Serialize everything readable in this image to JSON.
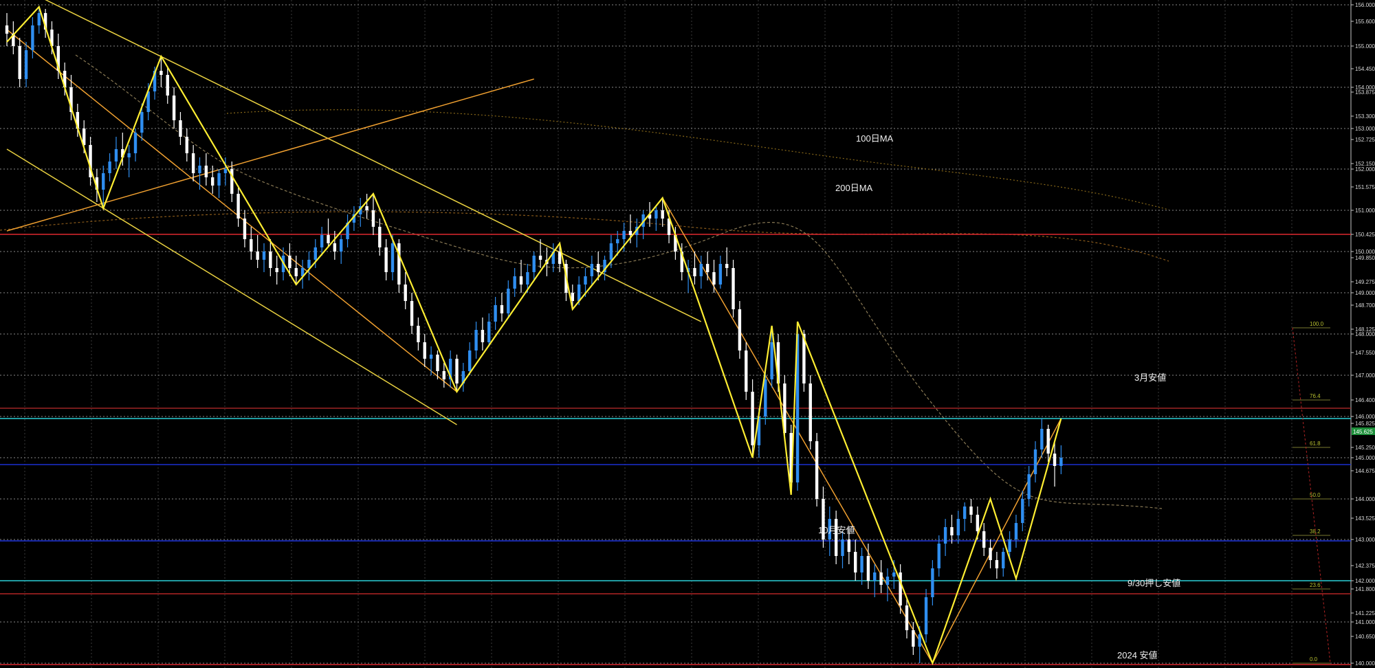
{
  "chart_data": {
    "type": "candlestick",
    "title": "",
    "xlabel": "",
    "ylabel": "",
    "ylim": [
      139.9,
      156.1
    ],
    "grid": true,
    "price_axis_labels": [
      "156.000",
      "155.600",
      "155.000",
      "154.450",
      "154.000",
      "153.875",
      "153.300",
      "153.000",
      "152.725",
      "152.150",
      "152.000",
      "151.575",
      "151.000",
      "150.425",
      "150.000",
      "149.850",
      "149.275",
      "149.000",
      "148.700",
      "148.125",
      "148.000",
      "147.550",
      "147.000",
      "146.400",
      "146.000",
      "145.825",
      "145.250",
      "145.000",
      "144.675",
      "144.000",
      "143.525",
      "143.000",
      "142.375",
      "142.000",
      "141.800",
      "141.225",
      "141.000",
      "140.650",
      "140.000"
    ],
    "price_marker": "145.625",
    "annotations": [
      {
        "text": "100日MA"
      },
      {
        "text": "200日MA"
      },
      {
        "text": "3月安値"
      },
      {
        "text": "10月安値"
      },
      {
        "text": "9/30押し安値"
      },
      {
        "text": "2024 安値"
      }
    ],
    "fib_labels": [
      "100.0",
      "76.4",
      "61.8",
      "50.0",
      "38.2",
      "23.6",
      "0.0"
    ],
    "horizontal_levels": [
      {
        "price": 150.425,
        "color": "#e0282f"
      },
      {
        "price": 146.2,
        "color": "#9e2626"
      },
      {
        "price": 145.95,
        "color": "#2ad0d8"
      },
      {
        "price": 144.82,
        "color": "#1a2fd0"
      },
      {
        "price": 142.98,
        "color": "#2036e0"
      },
      {
        "price": 142.0,
        "color": "#2ad0d8"
      },
      {
        "price": 141.68,
        "color": "#b32424"
      },
      {
        "price": 139.97,
        "color": "#e0282f"
      }
    ],
    "zigzag_pivots": [
      {
        "i": 0,
        "p": 155.1
      },
      {
        "i": 5,
        "p": 155.95
      },
      {
        "i": 15,
        "p": 151.05
      },
      {
        "i": 24,
        "p": 154.75
      },
      {
        "i": 45,
        "p": 149.2
      },
      {
        "i": 57,
        "p": 151.4
      },
      {
        "i": 70,
        "p": 146.6
      },
      {
        "i": 86,
        "p": 150.2
      },
      {
        "i": 88,
        "p": 148.6
      },
      {
        "i": 102,
        "p": 151.3
      },
      {
        "i": 116,
        "p": 145.0
      },
      {
        "i": 119,
        "p": 148.2
      },
      {
        "i": 122,
        "p": 144.1
      },
      {
        "i": 123,
        "p": 148.3
      },
      {
        "i": 144,
        "p": 140.0
      },
      {
        "i": 153,
        "p": 144.0
      },
      {
        "i": 157,
        "p": 142.05
      },
      {
        "i": 164,
        "p": 145.95
      }
    ],
    "candles_ohlc": [
      [
        155.5,
        155.8,
        155.0,
        155.3
      ],
      [
        155.3,
        155.6,
        154.8,
        155.0
      ],
      [
        155.0,
        155.2,
        154.0,
        154.2
      ],
      [
        154.2,
        155.1,
        154.0,
        154.9
      ],
      [
        154.9,
        155.7,
        154.7,
        155.5
      ],
      [
        155.5,
        155.95,
        155.3,
        155.8
      ],
      [
        155.8,
        155.9,
        155.2,
        155.4
      ],
      [
        155.4,
        155.6,
        154.8,
        155.0
      ],
      [
        155.0,
        155.3,
        154.2,
        154.4
      ],
      [
        154.4,
        154.6,
        153.8,
        154.0
      ],
      [
        154.0,
        154.3,
        153.2,
        153.4
      ],
      [
        153.4,
        153.6,
        152.8,
        153.0
      ],
      [
        153.0,
        153.2,
        152.4,
        152.6
      ],
      [
        152.6,
        152.8,
        151.6,
        151.8
      ],
      [
        151.8,
        152.0,
        151.2,
        151.5
      ],
      [
        151.5,
        152.1,
        151.05,
        151.9
      ],
      [
        151.9,
        152.4,
        151.7,
        152.2
      ],
      [
        152.2,
        152.8,
        152.0,
        152.5
      ],
      [
        152.5,
        152.9,
        152.1,
        152.3
      ],
      [
        152.3,
        152.6,
        151.8,
        152.4
      ],
      [
        152.4,
        153.0,
        152.2,
        152.9
      ],
      [
        152.9,
        153.6,
        152.7,
        153.4
      ],
      [
        153.4,
        154.1,
        153.2,
        153.9
      ],
      [
        153.9,
        154.5,
        153.7,
        154.4
      ],
      [
        154.4,
        154.75,
        154.0,
        154.3
      ],
      [
        154.3,
        154.5,
        153.6,
        153.8
      ],
      [
        153.8,
        154.0,
        153.0,
        153.2
      ],
      [
        153.2,
        153.4,
        152.6,
        152.8
      ],
      [
        152.8,
        153.0,
        152.2,
        152.4
      ],
      [
        152.4,
        152.6,
        151.7,
        151.9
      ],
      [
        151.9,
        152.3,
        151.5,
        152.1
      ],
      [
        152.1,
        152.4,
        151.6,
        151.8
      ],
      [
        151.8,
        152.1,
        151.4,
        151.6
      ],
      [
        151.6,
        152.0,
        151.3,
        151.9
      ],
      [
        151.9,
        152.3,
        151.6,
        152.0
      ],
      [
        152.0,
        152.2,
        151.2,
        151.4
      ],
      [
        151.4,
        151.6,
        150.6,
        150.8
      ],
      [
        150.8,
        151.0,
        150.1,
        150.3
      ],
      [
        150.3,
        150.6,
        149.8,
        150.0
      ],
      [
        150.0,
        150.4,
        149.6,
        149.8
      ],
      [
        149.8,
        150.2,
        149.5,
        150.0
      ],
      [
        150.0,
        150.3,
        149.4,
        149.6
      ],
      [
        149.6,
        149.9,
        149.2,
        149.5
      ],
      [
        149.5,
        150.1,
        149.3,
        149.9
      ],
      [
        149.9,
        150.2,
        149.4,
        149.6
      ],
      [
        149.6,
        149.9,
        149.2,
        149.4
      ],
      [
        149.4,
        149.8,
        149.1,
        149.6
      ],
      [
        149.6,
        150.0,
        149.3,
        149.8
      ],
      [
        149.8,
        150.3,
        149.6,
        150.1
      ],
      [
        150.1,
        150.6,
        149.9,
        150.4
      ],
      [
        150.4,
        150.8,
        150.1,
        150.2
      ],
      [
        150.2,
        150.5,
        149.8,
        150.0
      ],
      [
        150.0,
        150.4,
        149.7,
        150.3
      ],
      [
        150.3,
        150.9,
        150.1,
        150.7
      ],
      [
        150.7,
        151.1,
        150.5,
        150.9
      ],
      [
        150.9,
        151.3,
        150.6,
        151.1
      ],
      [
        151.1,
        151.4,
        150.8,
        151.0
      ],
      [
        151.0,
        151.4,
        150.4,
        150.6
      ],
      [
        150.6,
        150.8,
        149.9,
        150.1
      ],
      [
        150.1,
        150.3,
        149.3,
        149.5
      ],
      [
        149.5,
        150.4,
        149.3,
        150.2
      ],
      [
        150.2,
        150.3,
        149.0,
        149.2
      ],
      [
        149.2,
        149.5,
        148.6,
        148.8
      ],
      [
        148.8,
        149.0,
        148.0,
        148.2
      ],
      [
        148.2,
        148.4,
        147.6,
        147.8
      ],
      [
        147.8,
        148.0,
        147.2,
        147.4
      ],
      [
        147.4,
        147.7,
        147.0,
        147.5
      ],
      [
        147.5,
        147.6,
        146.9,
        147.1
      ],
      [
        147.1,
        147.3,
        146.7,
        146.9
      ],
      [
        146.9,
        147.6,
        146.7,
        147.4
      ],
      [
        147.4,
        147.5,
        146.6,
        146.8
      ],
      [
        146.8,
        147.3,
        146.6,
        147.1
      ],
      [
        147.1,
        147.8,
        147.0,
        147.6
      ],
      [
        147.6,
        148.3,
        147.4,
        148.1
      ],
      [
        148.1,
        148.4,
        147.6,
        147.8
      ],
      [
        147.8,
        148.5,
        147.7,
        148.3
      ],
      [
        148.3,
        148.9,
        148.1,
        148.7
      ],
      [
        148.7,
        149.0,
        148.3,
        148.5
      ],
      [
        148.5,
        149.3,
        148.4,
        149.1
      ],
      [
        149.1,
        149.6,
        148.9,
        149.4
      ],
      [
        149.4,
        149.8,
        149.0,
        149.2
      ],
      [
        149.2,
        149.7,
        149.0,
        149.5
      ],
      [
        149.5,
        150.0,
        149.3,
        149.9
      ],
      [
        149.9,
        150.3,
        149.6,
        149.8
      ],
      [
        149.8,
        150.1,
        149.4,
        149.7
      ],
      [
        149.7,
        150.2,
        149.5,
        150.0
      ],
      [
        150.0,
        150.2,
        149.5,
        149.7
      ],
      [
        149.7,
        149.8,
        148.8,
        149.0
      ],
      [
        149.0,
        149.2,
        148.6,
        148.8
      ],
      [
        148.8,
        149.4,
        148.7,
        149.2
      ],
      [
        149.2,
        149.6,
        148.9,
        149.4
      ],
      [
        149.4,
        149.9,
        149.2,
        149.7
      ],
      [
        149.7,
        150.0,
        149.3,
        149.5
      ],
      [
        149.5,
        149.9,
        149.3,
        149.8
      ],
      [
        149.8,
        150.4,
        149.6,
        150.2
      ],
      [
        150.2,
        150.5,
        149.9,
        150.3
      ],
      [
        150.3,
        150.7,
        150.0,
        150.5
      ],
      [
        150.5,
        150.9,
        150.2,
        150.4
      ],
      [
        150.4,
        150.8,
        150.1,
        150.6
      ],
      [
        150.6,
        151.0,
        150.3,
        150.9
      ],
      [
        150.9,
        151.2,
        150.6,
        150.8
      ],
      [
        150.8,
        151.1,
        150.5,
        151.0
      ],
      [
        151.0,
        151.3,
        150.6,
        150.8
      ],
      [
        150.8,
        151.0,
        150.2,
        150.4
      ],
      [
        150.4,
        150.6,
        149.8,
        150.0
      ],
      [
        150.0,
        150.2,
        149.3,
        149.5
      ],
      [
        149.5,
        149.8,
        149.0,
        149.6
      ],
      [
        149.6,
        150.0,
        149.2,
        149.4
      ],
      [
        149.4,
        149.9,
        149.1,
        149.7
      ],
      [
        149.7,
        150.0,
        149.3,
        149.5
      ],
      [
        149.5,
        149.8,
        149.0,
        149.2
      ],
      [
        149.2,
        149.9,
        149.1,
        149.7
      ],
      [
        149.7,
        150.1,
        149.4,
        149.6
      ],
      [
        149.6,
        149.8,
        148.4,
        148.6
      ],
      [
        148.6,
        148.8,
        147.4,
        147.6
      ],
      [
        147.6,
        147.8,
        146.4,
        146.6
      ],
      [
        146.6,
        146.9,
        145.0,
        145.3
      ],
      [
        145.3,
        146.2,
        145.0,
        146.0
      ],
      [
        146.0,
        147.1,
        145.8,
        146.9
      ],
      [
        146.9,
        148.2,
        146.7,
        147.8
      ],
      [
        147.8,
        148.0,
        146.6,
        146.8
      ],
      [
        146.8,
        147.0,
        145.4,
        145.6
      ],
      [
        145.6,
        145.8,
        144.1,
        144.4
      ],
      [
        144.4,
        148.3,
        144.2,
        148.0
      ],
      [
        148.0,
        148.1,
        146.6,
        146.8
      ],
      [
        146.8,
        147.0,
        145.2,
        145.4
      ],
      [
        145.4,
        145.6,
        143.8,
        144.0
      ],
      [
        144.0,
        144.3,
        142.8,
        143.0
      ],
      [
        143.0,
        143.8,
        142.6,
        143.5
      ],
      [
        143.5,
        143.7,
        142.4,
        142.6
      ],
      [
        142.6,
        143.2,
        142.3,
        143.0
      ],
      [
        143.0,
        143.3,
        142.4,
        142.7
      ],
      [
        142.7,
        143.0,
        142.0,
        142.2
      ],
      [
        142.2,
        142.8,
        141.9,
        142.6
      ],
      [
        142.6,
        142.9,
        141.8,
        142.0
      ],
      [
        142.0,
        142.4,
        141.6,
        142.2
      ],
      [
        142.2,
        142.5,
        141.7,
        141.9
      ],
      [
        141.9,
        142.3,
        141.5,
        142.1
      ],
      [
        142.1,
        142.5,
        141.8,
        142.2
      ],
      [
        142.2,
        142.4,
        141.2,
        141.4
      ],
      [
        141.4,
        141.6,
        140.6,
        140.8
      ],
      [
        140.8,
        141.0,
        140.2,
        140.4
      ],
      [
        140.4,
        140.9,
        140.0,
        140.7
      ],
      [
        140.7,
        141.8,
        140.5,
        141.6
      ],
      [
        141.6,
        142.5,
        141.4,
        142.3
      ],
      [
        142.3,
        143.1,
        142.1,
        142.9
      ],
      [
        142.9,
        143.5,
        142.6,
        143.3
      ],
      [
        143.3,
        143.6,
        142.9,
        143.1
      ],
      [
        143.1,
        143.7,
        142.9,
        143.5
      ],
      [
        143.5,
        143.9,
        143.2,
        143.8
      ],
      [
        143.8,
        144.0,
        143.4,
        143.6
      ],
      [
        143.6,
        143.8,
        143.0,
        143.2
      ],
      [
        143.2,
        143.4,
        142.6,
        142.8
      ],
      [
        142.8,
        143.0,
        142.3,
        142.5
      ],
      [
        142.5,
        142.7,
        142.05,
        142.3
      ],
      [
        142.3,
        142.8,
        142.1,
        142.7
      ],
      [
        142.7,
        143.2,
        142.5,
        143.0
      ],
      [
        143.0,
        143.6,
        142.8,
        143.4
      ],
      [
        143.4,
        144.2,
        143.2,
        144.0
      ],
      [
        144.0,
        144.8,
        143.8,
        144.6
      ],
      [
        144.6,
        145.4,
        144.4,
        145.2
      ],
      [
        145.2,
        145.95,
        145.0,
        145.7
      ],
      [
        145.7,
        145.8,
        144.9,
        145.1
      ],
      [
        145.1,
        145.4,
        144.3,
        144.8
      ],
      [
        144.8,
        145.3,
        144.6,
        145.0
      ]
    ]
  }
}
